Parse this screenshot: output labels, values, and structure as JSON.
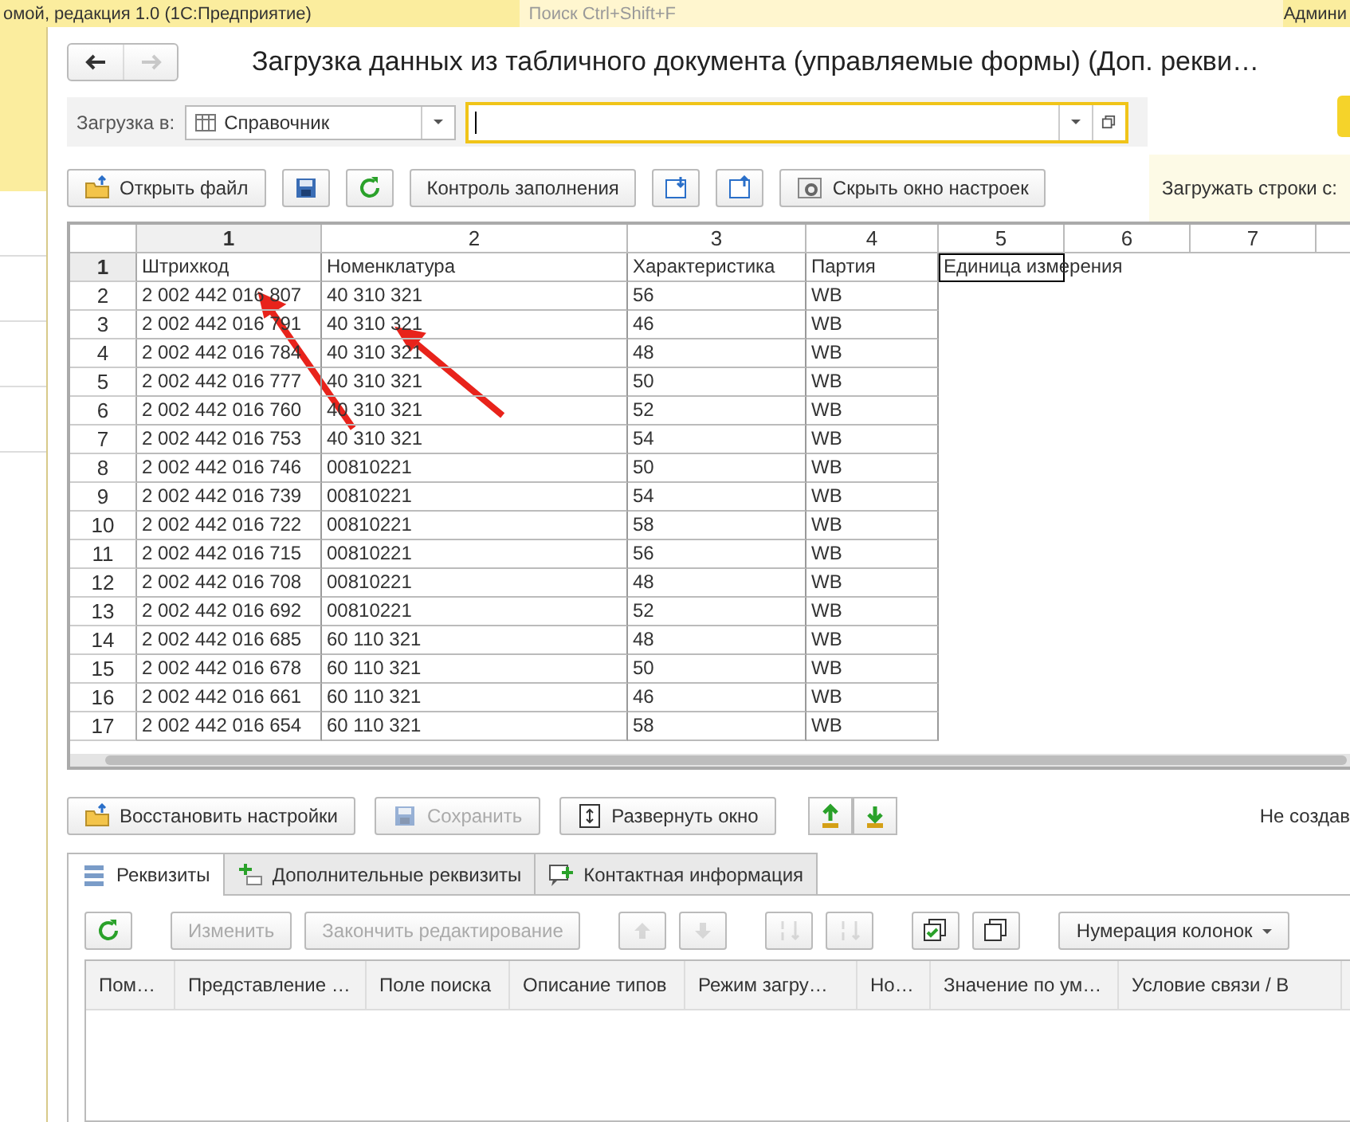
{
  "app_header": {
    "title": "омой, редакция 1.0  (1С:Предприятие)",
    "search_placeholder": "Поиск Ctrl+Shift+F",
    "user": "Админи"
  },
  "nav": [
    {
      "kind": "back",
      "disabled": false
    },
    {
      "kind": "forward",
      "disabled": true
    }
  ],
  "form_title": "Загрузка данных из табличного документа (управляемые формы) (Доп. рекви…",
  "load_target": {
    "label": "Загрузка в:",
    "type_value": "Справочник"
  },
  "toolbar": [
    {
      "kind": "open",
      "label": "Открыть файл"
    },
    {
      "kind": "save"
    },
    {
      "kind": "refresh"
    },
    {
      "kind": "text",
      "label": "Контроль заполнения"
    },
    {
      "kind": "import"
    },
    {
      "kind": "export"
    },
    {
      "kind": "settings",
      "label": "Скрыть окно настроек"
    }
  ],
  "load_rows_label": "Загружать строки с:",
  "sheet": {
    "columns": [
      {
        "label": "1",
        "selected": true
      },
      {
        "label": "2",
        "selected": false
      },
      {
        "label": "3",
        "selected": false
      },
      {
        "label": "4",
        "selected": false
      },
      {
        "label": "5",
        "selected": false
      },
      {
        "label": "6",
        "selected": false
      },
      {
        "label": "7",
        "selected": false
      }
    ],
    "rows": [
      {
        "number": "1",
        "selected": true,
        "cells": [
          "Штрихкод",
          "Номенклатура",
          "Характеристика",
          "Партия",
          "Единица измерения"
        ]
      },
      {
        "number": "2",
        "selected": false,
        "cells": [
          "2 002 442 016 807",
          "40 310 321",
          "56",
          "WB"
        ]
      },
      {
        "number": "3",
        "selected": false,
        "cells": [
          "2 002 442 016 791",
          "40 310 321",
          "46",
          "WB"
        ]
      },
      {
        "number": "4",
        "selected": false,
        "cells": [
          "2 002 442 016 784",
          "40 310 321",
          "48",
          "WB"
        ]
      },
      {
        "number": "5",
        "selected": false,
        "cells": [
          "2 002 442 016 777",
          "40 310 321",
          "50",
          "WB"
        ]
      },
      {
        "number": "6",
        "selected": false,
        "cells": [
          "2 002 442 016 760",
          "40 310 321",
          "52",
          "WB"
        ]
      },
      {
        "number": "7",
        "selected": false,
        "cells": [
          "2 002 442 016 753",
          "40 310 321",
          "54",
          "WB"
        ]
      },
      {
        "number": "8",
        "selected": false,
        "cells": [
          "2 002 442 016 746",
          "00810221",
          "50",
          "WB"
        ]
      },
      {
        "number": "9",
        "selected": false,
        "cells": [
          "2 002 442 016 739",
          "00810221",
          "54",
          "WB"
        ]
      },
      {
        "number": "10",
        "selected": false,
        "cells": [
          "2 002 442 016 722",
          "00810221",
          "58",
          "WB"
        ]
      },
      {
        "number": "11",
        "selected": false,
        "cells": [
          "2 002 442 016 715",
          "00810221",
          "56",
          "WB"
        ]
      },
      {
        "number": "12",
        "selected": false,
        "cells": [
          "2 002 442 016 708",
          "00810221",
          "48",
          "WB"
        ]
      },
      {
        "number": "13",
        "selected": false,
        "cells": [
          "2 002 442 016 692",
          "00810221",
          "52",
          "WB"
        ]
      },
      {
        "number": "14",
        "selected": false,
        "cells": [
          "2 002 442 016 685",
          "60 110 321",
          "48",
          "WB"
        ]
      },
      {
        "number": "15",
        "selected": false,
        "cells": [
          "2 002 442 016 678",
          "60 110 321",
          "50",
          "WB"
        ]
      },
      {
        "number": "16",
        "selected": false,
        "cells": [
          "2 002 442 016 661",
          "60 110 321",
          "46",
          "WB"
        ]
      },
      {
        "number": "17",
        "selected": false,
        "cells": [
          "2 002 442 016 654",
          "60 110 321",
          "58",
          "WB"
        ]
      }
    ]
  },
  "bottom_buttons": [
    {
      "kind": "restore",
      "label": "Восстановить настройки",
      "disabled": false
    },
    {
      "kind": "save",
      "label": "Сохранить",
      "disabled": true
    },
    {
      "kind": "expand",
      "label": "Развернуть окно",
      "disabled": false
    },
    {
      "kind": "upload"
    },
    {
      "kind": "download"
    }
  ],
  "status_text": "Не создав",
  "tabs": [
    {
      "kind": "list",
      "label": "Реквизиты",
      "selected": true
    },
    {
      "kind": "add",
      "label": "Дополнительные реквизиты",
      "selected": false
    },
    {
      "kind": "contact",
      "label": "Контактная информация",
      "selected": false
    }
  ],
  "grid_toolbar": [
    {
      "kind": "refresh",
      "disabled": false
    },
    {
      "kind": "text",
      "label": "Изменить",
      "disabled": true
    },
    {
      "kind": "text",
      "label": "Закончить редактирование",
      "disabled": true
    },
    {
      "kind": "up",
      "disabled": true
    },
    {
      "kind": "down",
      "disabled": true
    },
    {
      "kind": "sort-asc",
      "disabled": true
    },
    {
      "kind": "sort-desc",
      "disabled": true
    },
    {
      "kind": "check-all",
      "disabled": false
    },
    {
      "kind": "uncheck-all",
      "disabled": false
    },
    {
      "kind": "dropdown",
      "label": "Нумерация колонок",
      "disabled": false
    }
  ],
  "table": {
    "columns": [
      "Пом…",
      "Представление …",
      "Поле поиска",
      "Описание типов",
      "Режим загру…",
      "Но…",
      "Значение по ум…",
      "Условие связи / В"
    ]
  }
}
